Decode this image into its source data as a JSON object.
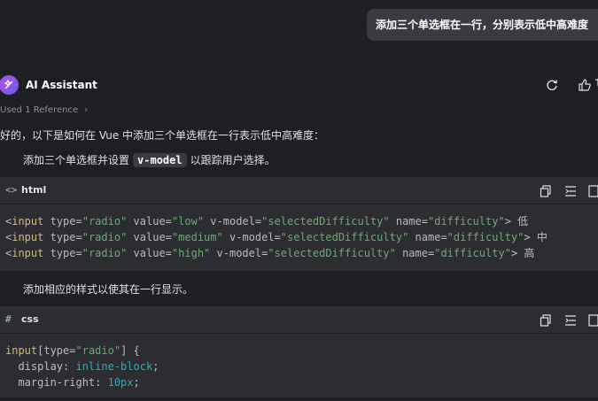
{
  "user_message": "添加三个单选框在一行，分别表示低中高难度",
  "assistant": {
    "name": "AI Assistant",
    "reference": "Used 1 Reference"
  },
  "intro": "好的，以下是如何在 Vue 中添加三个单选框在一行表示低中高难度：",
  "step1": {
    "before": "添加三个单选框并设置",
    "code": "v-model",
    "after": "以跟踪用户选择。"
  },
  "step2": {
    "text": "添加相应的样式以使其在一行显示。"
  },
  "html_block": {
    "lang": "html",
    "lines": [
      {
        "tag": "input",
        "value": "low",
        "model": "selectedDifficulty",
        "name": "difficulty",
        "label": "低"
      },
      {
        "tag": "input",
        "value": "medium",
        "model": "selectedDifficulty",
        "name": "difficulty",
        "label": "中"
      },
      {
        "tag": "input",
        "value": "high",
        "model": "selectedDifficulty",
        "name": "difficulty",
        "label": "高"
      }
    ]
  },
  "css_block": {
    "lang": "css",
    "selector_el": "input",
    "selector_attr": "type",
    "selector_val": "\"radio\"",
    "props": [
      {
        "name": "display",
        "value": "inline-block"
      },
      {
        "name": "margin-right",
        "value": "10px"
      }
    ]
  }
}
